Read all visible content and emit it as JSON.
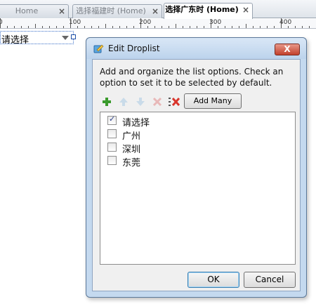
{
  "tabs": [
    {
      "label": "Home",
      "active": false
    },
    {
      "label": "选择福建时 (Home)",
      "active": false
    },
    {
      "label": "选择广东时 (Home)",
      "active": true
    }
  ],
  "tab_close_glyph": "×",
  "ruler": {
    "labels": [
      "0",
      "100",
      "200",
      "300",
      "400"
    ]
  },
  "canvas": {
    "droplist_value": "请选择"
  },
  "dialog": {
    "title": "Edit Droplist",
    "close_glyph": "X",
    "description": "Add and organize the list options. Check an option to set it to be selected by default.",
    "toolbar": {
      "add_icon": "add-icon",
      "move_up_icon": "move-up-icon",
      "move_down_icon": "move-down-icon",
      "delete_icon": "delete-icon",
      "delete_all_icon": "delete-all-icon",
      "add_many_label": "Add Many"
    },
    "options": [
      {
        "label": "请选择",
        "checked": true
      },
      {
        "label": "广州",
        "checked": false
      },
      {
        "label": "深圳",
        "checked": false
      },
      {
        "label": "东莞",
        "checked": false
      }
    ],
    "ok_label": "OK",
    "cancel_label": "Cancel"
  },
  "colors": {
    "accent": "#3c7fb1",
    "close_red": "#c2402c",
    "add_green": "#3a9a2c"
  }
}
